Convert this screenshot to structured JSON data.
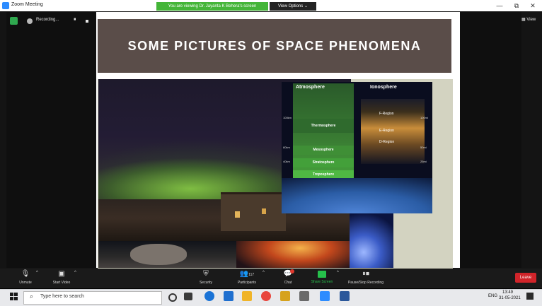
{
  "titlebar": {
    "title": "Zoom Meeting",
    "viewing_banner": "You are viewing Dr. Jayanta K Behera's screen",
    "view_options": "View Options ⌄",
    "minimize": "—",
    "maximize": "⧉",
    "close": "✕"
  },
  "recording": {
    "label": "Recording...",
    "pause": "⏸"
  },
  "view_button": "▦ View",
  "slide": {
    "title": "SOME PICTURES OF SPACE PHENOMENA",
    "atmosphere_header": "Atmosphere",
    "ionosphere_header": "Ionosphere",
    "atmosphere_layers": [
      "Thermosphere",
      "Mesosphere",
      "Stratosphere",
      "Troposphere"
    ],
    "ionosphere_layers": [
      "F-Region",
      "E-Region",
      "D-Region"
    ],
    "altitudes_left": [
      "100km",
      "80km",
      "40km"
    ],
    "altitudes_right": [
      "100mi",
      "50mi",
      "25mi"
    ]
  },
  "toolbar": {
    "unmute": "Unmute",
    "start_video": "Start Video",
    "security": "Security",
    "participants": "Participants",
    "participants_count": "117",
    "chat": "Chat",
    "share_screen": "Share Screen",
    "pause_recording": "Pause/Stop Recording",
    "leave": "Leave"
  },
  "taskbar": {
    "search_placeholder": "Type here to search",
    "language": "ENG",
    "time": "13:49",
    "date": "31-05-2021"
  },
  "colors": {
    "share_green": "#26c04b",
    "leave_red": "#d1242a",
    "banner_green": "#44b538",
    "slide_title_bg": "#5a4d49"
  }
}
